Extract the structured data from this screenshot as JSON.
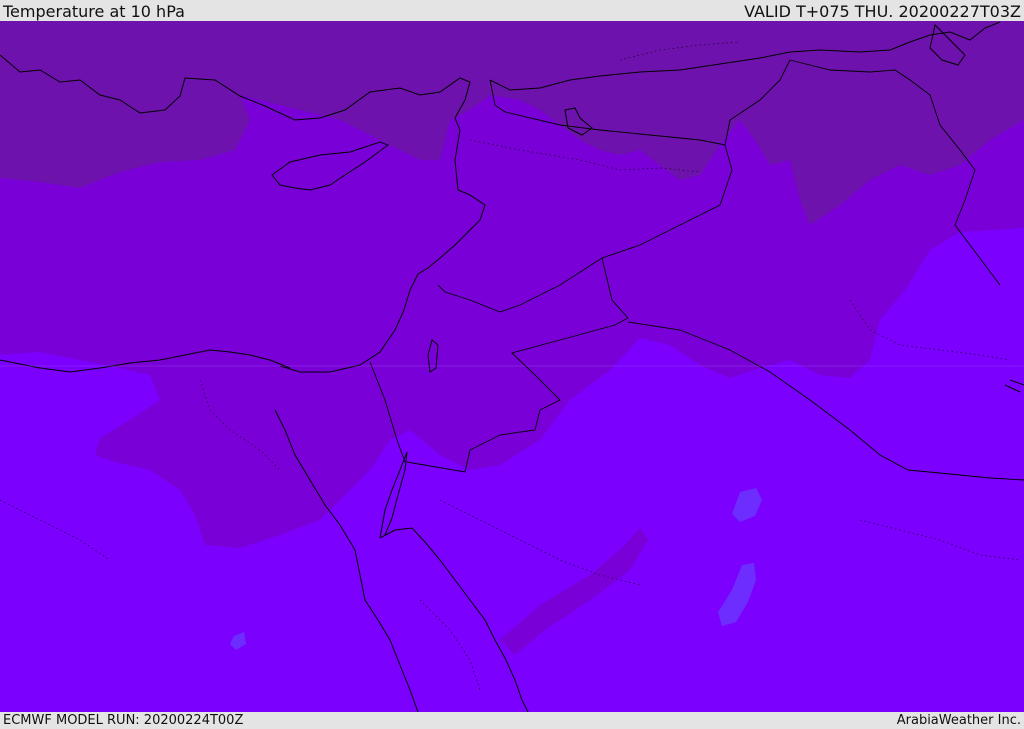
{
  "header": {
    "title": "Temperature at 10 hPa",
    "valid": "VALID T+075 THU. 20200227T03Z"
  },
  "footer": {
    "model_run": "ECMWF MODEL RUN: 20200224T00Z",
    "credit": "ArabiaWeather Inc."
  },
  "colors": {
    "background": "#e4e4e4",
    "field_cold": "#6e12ad",
    "field_mid": "#7a00d8",
    "field_warm": "#7b00fd",
    "field_warmest": "#6a3cff",
    "coastline": "#000000",
    "border": "#000000"
  }
}
